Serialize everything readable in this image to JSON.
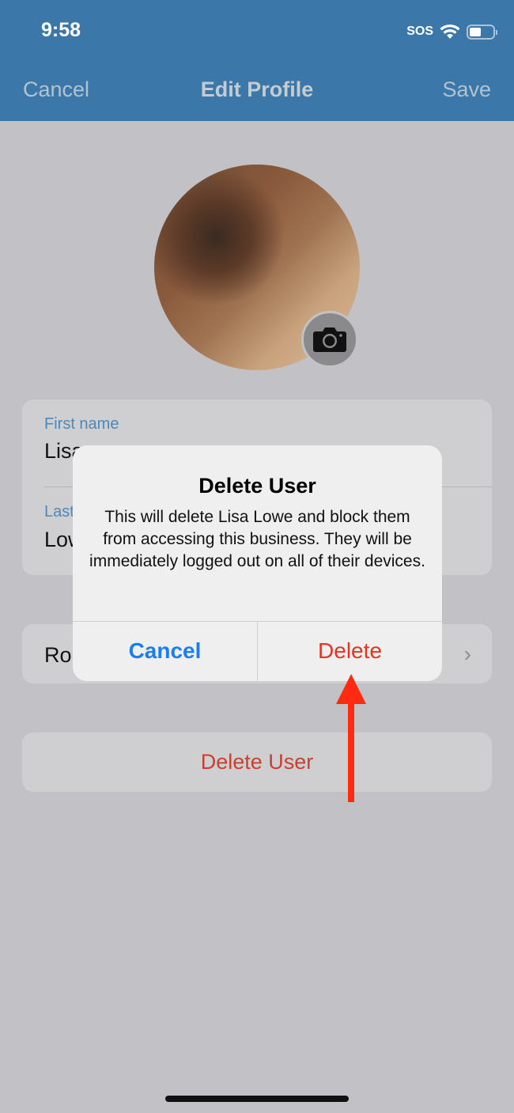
{
  "status_bar": {
    "time": "9:58",
    "carrier": "SOS",
    "wifi_icon": "wifi-icon",
    "battery_icon": "battery-icon"
  },
  "nav": {
    "cancel": "Cancel",
    "title": "Edit Profile",
    "save": "Save"
  },
  "colors": {
    "nav_bg": "#3b78a9",
    "destructive": "#e8311f",
    "accent": "#1a7ef3",
    "annotation_arrow": "#ff2a12"
  },
  "form": {
    "first_name_label": "First name",
    "first_name_value": "Lisa",
    "last_name_label": "Last name",
    "last_name_value": "Lowe",
    "role_label": "Role",
    "delete_user": "Delete User"
  },
  "dialog": {
    "title": "Delete User",
    "message": "This will delete Lisa Lowe and block them from accessing this business. They will be immediately logged out on all of their devices.",
    "cancel": "Cancel",
    "delete": "Delete"
  }
}
